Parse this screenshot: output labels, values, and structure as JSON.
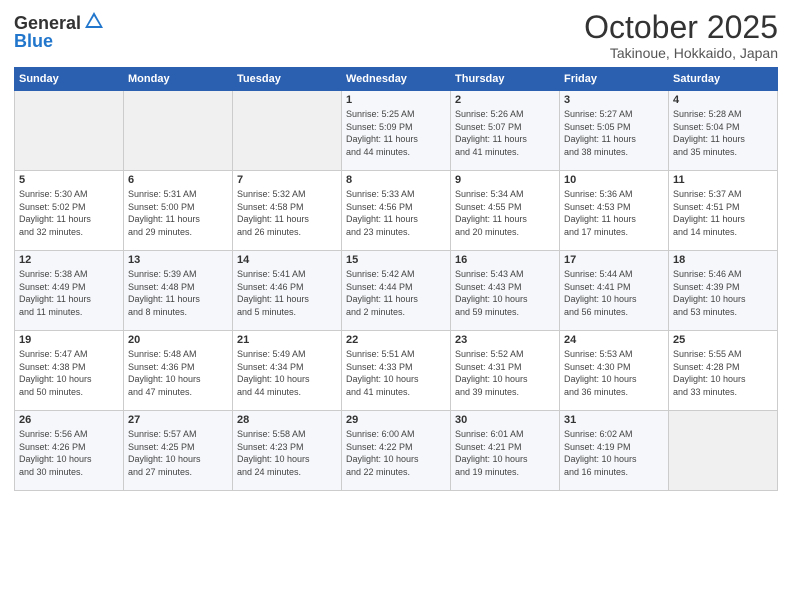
{
  "header": {
    "logo_general": "General",
    "logo_blue": "Blue",
    "month_title": "October 2025",
    "location": "Takinoue, Hokkaido, Japan"
  },
  "days_of_week": [
    "Sunday",
    "Monday",
    "Tuesday",
    "Wednesday",
    "Thursday",
    "Friday",
    "Saturday"
  ],
  "weeks": [
    [
      {
        "day": "",
        "content": ""
      },
      {
        "day": "",
        "content": ""
      },
      {
        "day": "",
        "content": ""
      },
      {
        "day": "1",
        "content": "Sunrise: 5:25 AM\nSunset: 5:09 PM\nDaylight: 11 hours\nand 44 minutes."
      },
      {
        "day": "2",
        "content": "Sunrise: 5:26 AM\nSunset: 5:07 PM\nDaylight: 11 hours\nand 41 minutes."
      },
      {
        "day": "3",
        "content": "Sunrise: 5:27 AM\nSunset: 5:05 PM\nDaylight: 11 hours\nand 38 minutes."
      },
      {
        "day": "4",
        "content": "Sunrise: 5:28 AM\nSunset: 5:04 PM\nDaylight: 11 hours\nand 35 minutes."
      }
    ],
    [
      {
        "day": "5",
        "content": "Sunrise: 5:30 AM\nSunset: 5:02 PM\nDaylight: 11 hours\nand 32 minutes."
      },
      {
        "day": "6",
        "content": "Sunrise: 5:31 AM\nSunset: 5:00 PM\nDaylight: 11 hours\nand 29 minutes."
      },
      {
        "day": "7",
        "content": "Sunrise: 5:32 AM\nSunset: 4:58 PM\nDaylight: 11 hours\nand 26 minutes."
      },
      {
        "day": "8",
        "content": "Sunrise: 5:33 AM\nSunset: 4:56 PM\nDaylight: 11 hours\nand 23 minutes."
      },
      {
        "day": "9",
        "content": "Sunrise: 5:34 AM\nSunset: 4:55 PM\nDaylight: 11 hours\nand 20 minutes."
      },
      {
        "day": "10",
        "content": "Sunrise: 5:36 AM\nSunset: 4:53 PM\nDaylight: 11 hours\nand 17 minutes."
      },
      {
        "day": "11",
        "content": "Sunrise: 5:37 AM\nSunset: 4:51 PM\nDaylight: 11 hours\nand 14 minutes."
      }
    ],
    [
      {
        "day": "12",
        "content": "Sunrise: 5:38 AM\nSunset: 4:49 PM\nDaylight: 11 hours\nand 11 minutes."
      },
      {
        "day": "13",
        "content": "Sunrise: 5:39 AM\nSunset: 4:48 PM\nDaylight: 11 hours\nand 8 minutes."
      },
      {
        "day": "14",
        "content": "Sunrise: 5:41 AM\nSunset: 4:46 PM\nDaylight: 11 hours\nand 5 minutes."
      },
      {
        "day": "15",
        "content": "Sunrise: 5:42 AM\nSunset: 4:44 PM\nDaylight: 11 hours\nand 2 minutes."
      },
      {
        "day": "16",
        "content": "Sunrise: 5:43 AM\nSunset: 4:43 PM\nDaylight: 10 hours\nand 59 minutes."
      },
      {
        "day": "17",
        "content": "Sunrise: 5:44 AM\nSunset: 4:41 PM\nDaylight: 10 hours\nand 56 minutes."
      },
      {
        "day": "18",
        "content": "Sunrise: 5:46 AM\nSunset: 4:39 PM\nDaylight: 10 hours\nand 53 minutes."
      }
    ],
    [
      {
        "day": "19",
        "content": "Sunrise: 5:47 AM\nSunset: 4:38 PM\nDaylight: 10 hours\nand 50 minutes."
      },
      {
        "day": "20",
        "content": "Sunrise: 5:48 AM\nSunset: 4:36 PM\nDaylight: 10 hours\nand 47 minutes."
      },
      {
        "day": "21",
        "content": "Sunrise: 5:49 AM\nSunset: 4:34 PM\nDaylight: 10 hours\nand 44 minutes."
      },
      {
        "day": "22",
        "content": "Sunrise: 5:51 AM\nSunset: 4:33 PM\nDaylight: 10 hours\nand 41 minutes."
      },
      {
        "day": "23",
        "content": "Sunrise: 5:52 AM\nSunset: 4:31 PM\nDaylight: 10 hours\nand 39 minutes."
      },
      {
        "day": "24",
        "content": "Sunrise: 5:53 AM\nSunset: 4:30 PM\nDaylight: 10 hours\nand 36 minutes."
      },
      {
        "day": "25",
        "content": "Sunrise: 5:55 AM\nSunset: 4:28 PM\nDaylight: 10 hours\nand 33 minutes."
      }
    ],
    [
      {
        "day": "26",
        "content": "Sunrise: 5:56 AM\nSunset: 4:26 PM\nDaylight: 10 hours\nand 30 minutes."
      },
      {
        "day": "27",
        "content": "Sunrise: 5:57 AM\nSunset: 4:25 PM\nDaylight: 10 hours\nand 27 minutes."
      },
      {
        "day": "28",
        "content": "Sunrise: 5:58 AM\nSunset: 4:23 PM\nDaylight: 10 hours\nand 24 minutes."
      },
      {
        "day": "29",
        "content": "Sunrise: 6:00 AM\nSunset: 4:22 PM\nDaylight: 10 hours\nand 22 minutes."
      },
      {
        "day": "30",
        "content": "Sunrise: 6:01 AM\nSunset: 4:21 PM\nDaylight: 10 hours\nand 19 minutes."
      },
      {
        "day": "31",
        "content": "Sunrise: 6:02 AM\nSunset: 4:19 PM\nDaylight: 10 hours\nand 16 minutes."
      },
      {
        "day": "",
        "content": ""
      }
    ]
  ]
}
